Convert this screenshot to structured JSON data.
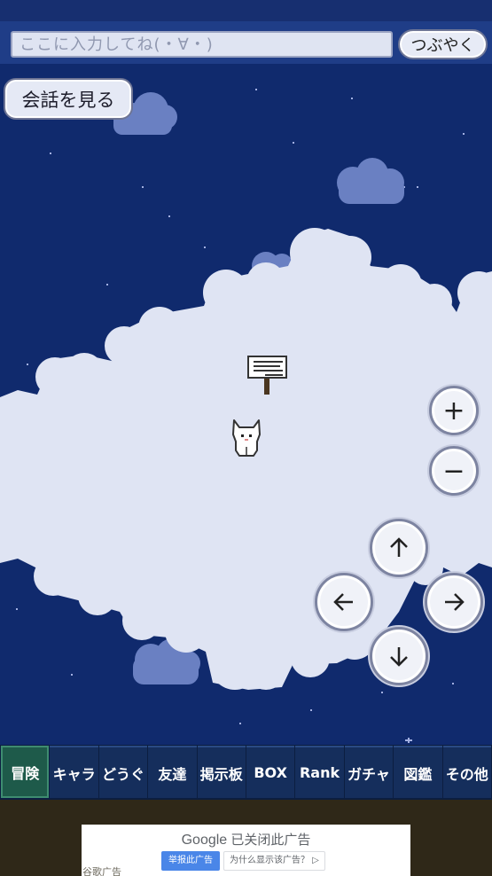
{
  "chat": {
    "placeholder": "ここに入力してね(・∀・)",
    "tweet_label": "つぶやく"
  },
  "view_chat_label": "会話を見る",
  "controls": {
    "zoom_in": "+",
    "zoom_out": "−"
  },
  "menu": {
    "tabs": [
      {
        "label": "冒険",
        "active": true
      },
      {
        "label": "キャラ"
      },
      {
        "label": "どうぐ"
      },
      {
        "label": "友達"
      },
      {
        "label": "掲示板"
      },
      {
        "label": "BOX"
      },
      {
        "label": "Rank"
      },
      {
        "label": "ガチャ"
      },
      {
        "label": "図鑑"
      },
      {
        "label": "その他"
      }
    ]
  },
  "ad": {
    "google": "Google",
    "closed_text": "已关闭此广告",
    "report_label": "举报此广告",
    "why_label": "为什么显示该广告？ ▷",
    "under_label": "谷歌广告"
  },
  "colors": {
    "sky": "#102a6d",
    "cloud": "#dfe4f3",
    "cloud_dim": "#6f86c6",
    "active_tab": "#1e5a4a"
  }
}
